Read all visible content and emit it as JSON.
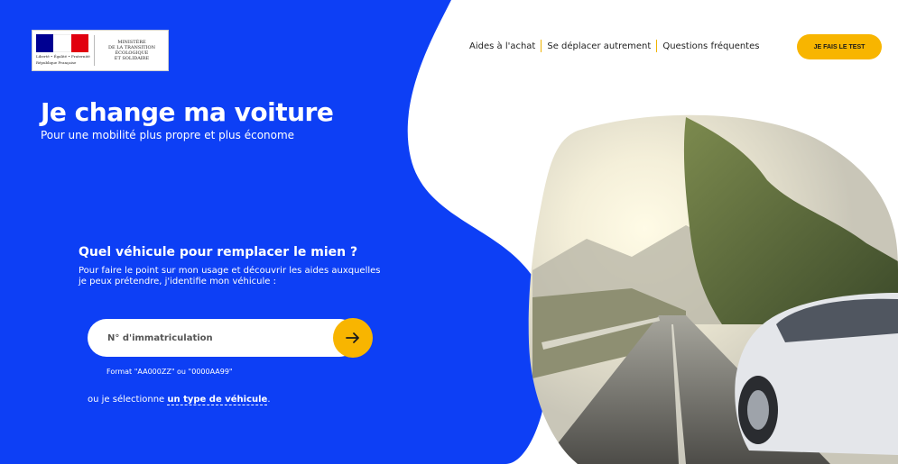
{
  "logo": {
    "motto": "Liberté • Égalité • Fraternité",
    "country": "République Française",
    "ministry_lines": [
      "MINISTÈRE",
      "DE LA TRANSITION",
      "ÉCOLOGIQUE",
      "ET SOLIDAIRE"
    ]
  },
  "nav": {
    "items": [
      {
        "label": "Aides à l'achat"
      },
      {
        "label": "Se déplacer autrement"
      },
      {
        "label": "Questions fréquentes"
      }
    ],
    "cta_label": "JE FAIS LE TEST"
  },
  "hero": {
    "title": "Je change ma voiture",
    "subtitle": "Pour une mobilité plus propre et plus économe"
  },
  "form": {
    "question": "Quel véhicule pour remplacer le mien ?",
    "description": "Pour faire le point sur mon usage et découvrir les aides auxquelles je peux prétendre, j'identifie mon véhicule :",
    "input_value": "",
    "input_placeholder": "N° d'immatriculation",
    "format_hint": "Format \"AA000ZZ\" ou \"0000AA99\"",
    "alt_prefix": "ou je sélectionne ",
    "alt_link": "un type de véhicule",
    "alt_suffix": "."
  },
  "colors": {
    "brand_blue": "#0d3ff5",
    "accent_yellow": "#f8b500"
  },
  "icons": {
    "submit": "arrow-right-icon"
  }
}
